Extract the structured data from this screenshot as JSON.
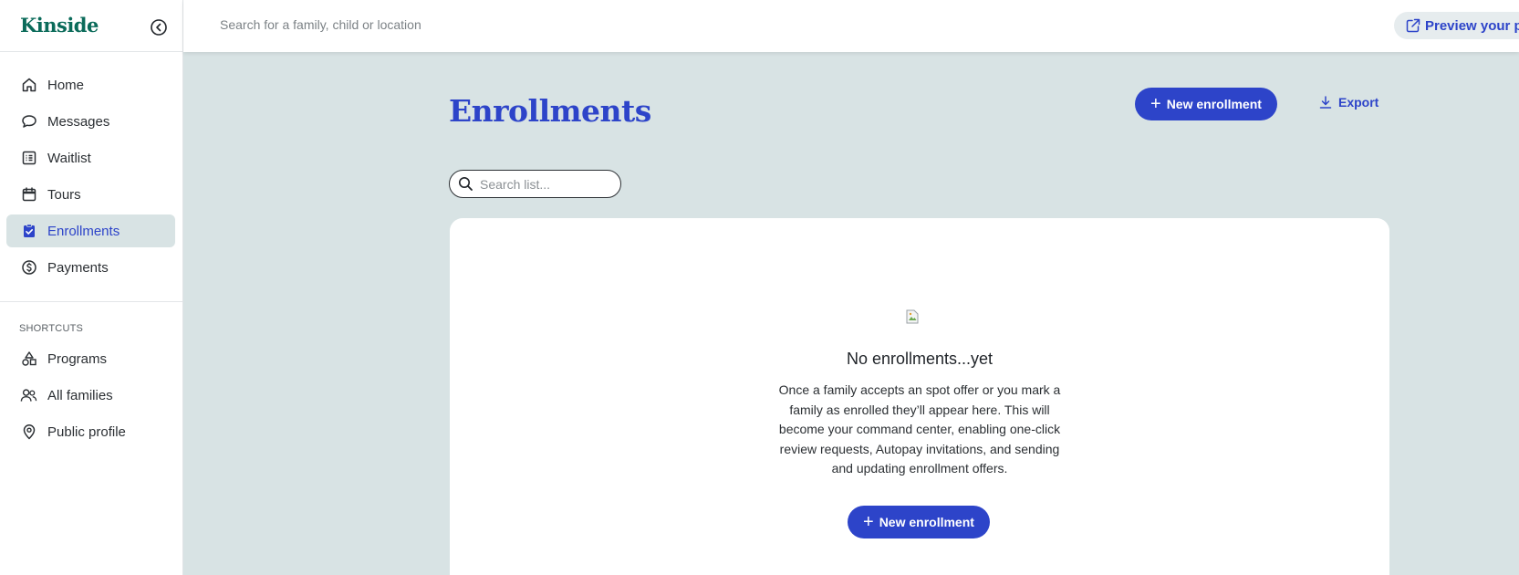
{
  "app": {
    "logo": "Kinside"
  },
  "topbar": {
    "search_placeholder": "Search for a family, child or location",
    "preview_label": "Preview your pro"
  },
  "sidebar": {
    "nav": [
      {
        "label": "Home",
        "icon": "home-icon"
      },
      {
        "label": "Messages",
        "icon": "chat-bubble-icon"
      },
      {
        "label": "Waitlist",
        "icon": "list-icon"
      },
      {
        "label": "Tours",
        "icon": "calendar-icon"
      },
      {
        "label": "Enrollments",
        "icon": "clipboard-check-icon",
        "active": true
      },
      {
        "label": "Payments",
        "icon": "dollar-circle-icon"
      }
    ],
    "shortcuts_label": "SHORTCUTS",
    "shortcuts": [
      {
        "label": "Programs",
        "icon": "shapes-icon"
      },
      {
        "label": "All families",
        "icon": "users-icon"
      },
      {
        "label": "Public profile",
        "icon": "location-pin-icon"
      }
    ]
  },
  "main": {
    "title": "Enrollments",
    "new_enrollment_label": "New enrollment",
    "export_label": "Export",
    "list_search_placeholder": "Search list...",
    "empty": {
      "title": "No enrollments...yet",
      "description": "Once a family accepts an spot offer or you mark a family as enrolled they’ll appear here. This will become your command center, enabling one-click review requests, Autopay invitations, and sending and updating enrollment offers.",
      "button_label": "New enrollment"
    }
  },
  "colors": {
    "accent": "#2d44c9",
    "brand_green": "#0b6b5a",
    "page_bg": "#d8e3e4"
  }
}
